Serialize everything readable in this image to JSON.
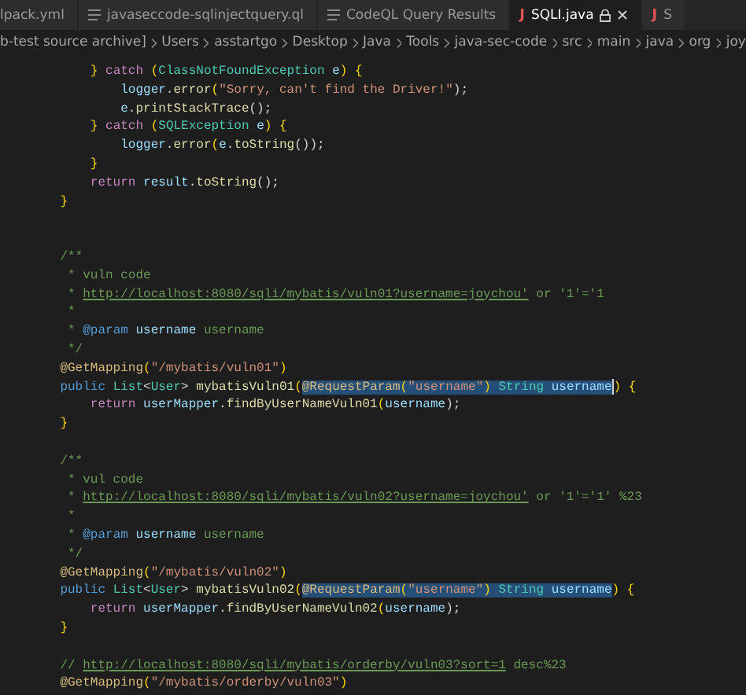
{
  "tabs": [
    {
      "label": "lpack.yml",
      "kind": "plain",
      "selected": false,
      "readonly": false
    },
    {
      "label": "javaseccode-sqlinjectquery.ql",
      "kind": "query",
      "selected": false,
      "readonly": false
    },
    {
      "label": "CodeQL Query Results",
      "kind": "query",
      "selected": false,
      "readonly": false
    },
    {
      "label": "SQLI.java",
      "kind": "java",
      "icon_text": "J",
      "selected": true,
      "readonly": true
    },
    {
      "label": "S",
      "kind": "java",
      "icon_text": "J",
      "selected": false,
      "readonly": false
    }
  ],
  "breadcrumb": [
    "b-test source archive]",
    "Users",
    "asstartgo",
    "Desktop",
    "Java",
    "Tools",
    "java-sec-code",
    "src",
    "main",
    "java",
    "org",
    "joy"
  ],
  "lines": [
    {
      "kind": "code",
      "t": [
        {
          "s": "        } ",
          "kind": "br"
        },
        {
          "s": "catch ",
          "kind": "kw"
        },
        {
          "s": "(",
          "kind": "br"
        },
        {
          "s": "ClassNotFoundException ",
          "kind": "type"
        },
        {
          "s": "e",
          "kind": "var"
        },
        {
          "s": ") {",
          "kind": "br"
        }
      ]
    },
    {
      "kind": "code",
      "t": [
        {
          "s": "            logger",
          "kind": "var"
        },
        {
          "s": ".",
          "kind": "p"
        },
        {
          "s": "error",
          "kind": "fn"
        },
        {
          "s": "(",
          "kind": "br"
        },
        {
          "s": "\"Sorry, can't find the Driver!\"",
          "kind": "str"
        },
        {
          "s": ");",
          "kind": "p"
        }
      ]
    },
    {
      "kind": "code",
      "t": [
        {
          "s": "            e",
          "kind": "var"
        },
        {
          "s": ".",
          "kind": "p"
        },
        {
          "s": "printStackTrace",
          "kind": "fn"
        },
        {
          "s": "();",
          "kind": "p"
        }
      ]
    },
    {
      "kind": "code",
      "t": [
        {
          "s": "        } ",
          "kind": "br"
        },
        {
          "s": "catch ",
          "kind": "kw"
        },
        {
          "s": "(",
          "kind": "br"
        },
        {
          "s": "SQLException ",
          "kind": "type"
        },
        {
          "s": "e",
          "kind": "var"
        },
        {
          "s": ") {",
          "kind": "br"
        }
      ]
    },
    {
      "kind": "code",
      "t": [
        {
          "s": "            logger",
          "kind": "var"
        },
        {
          "s": ".",
          "kind": "p"
        },
        {
          "s": "error",
          "kind": "fn"
        },
        {
          "s": "(",
          "kind": "br"
        },
        {
          "s": "e",
          "kind": "var"
        },
        {
          "s": ".",
          "kind": "p"
        },
        {
          "s": "toString",
          "kind": "fn"
        },
        {
          "s": "());",
          "kind": "p"
        }
      ]
    },
    {
      "kind": "code",
      "t": [
        {
          "s": "        }",
          "kind": "br"
        }
      ]
    },
    {
      "kind": "code",
      "t": [
        {
          "s": "        return ",
          "kind": "kw"
        },
        {
          "s": "result",
          "kind": "var"
        },
        {
          "s": ".",
          "kind": "p"
        },
        {
          "s": "toString",
          "kind": "fn"
        },
        {
          "s": "();",
          "kind": "p"
        }
      ]
    },
    {
      "kind": "code",
      "t": [
        {
          "s": "    }",
          "kind": "br"
        }
      ]
    },
    {
      "kind": "blank"
    },
    {
      "kind": "blank"
    },
    {
      "kind": "code",
      "t": [
        {
          "s": "    /**",
          "kind": "cm"
        }
      ]
    },
    {
      "kind": "code",
      "t": [
        {
          "s": "     * vuln code",
          "kind": "cm"
        }
      ]
    },
    {
      "kind": "code",
      "t": [
        {
          "s": "     * ",
          "kind": "cm"
        },
        {
          "s": "http://localhost:8080/sqli/mybatis/vuln01?username=joychou'",
          "kind": "link"
        },
        {
          "s": " or '1'='1",
          "kind": "cm"
        }
      ]
    },
    {
      "kind": "code",
      "t": [
        {
          "s": "     *",
          "kind": "cm"
        }
      ]
    },
    {
      "kind": "code",
      "t": [
        {
          "s": "     * ",
          "kind": "cm"
        },
        {
          "s": "@param ",
          "kind": "doc"
        },
        {
          "s": "username ",
          "kind": "var"
        },
        {
          "s": "username",
          "kind": "cm"
        }
      ]
    },
    {
      "kind": "code",
      "t": [
        {
          "s": "     */",
          "kind": "cm"
        }
      ]
    },
    {
      "kind": "code",
      "t": [
        {
          "s": "    @GetMapping",
          "kind": "ann"
        },
        {
          "s": "(",
          "kind": "br"
        },
        {
          "s": "\"/mybatis/vuln01\"",
          "kind": "str"
        },
        {
          "s": ")",
          "kind": "br"
        }
      ]
    },
    {
      "kind": "code",
      "t": [
        {
          "s": "    public ",
          "kind": "kw2"
        },
        {
          "s": "List",
          "kind": "type"
        },
        {
          "s": "<",
          "kind": "p"
        },
        {
          "s": "User",
          "kind": "type"
        },
        {
          "s": "> ",
          "kind": "p"
        },
        {
          "s": "mybatisVuln01",
          "kind": "fn"
        },
        {
          "s": "(",
          "kind": "br"
        },
        {
          "kind": "selection",
          "t": [
            {
              "s": "@RequestParam",
              "kind": "ann"
            },
            {
              "s": "(",
              "kind": "br"
            },
            {
              "s": "\"username\"",
              "kind": "str"
            },
            {
              "s": ") ",
              "kind": "br"
            },
            {
              "s": "String ",
              "kind": "type"
            },
            {
              "s": "username",
              "kind": "var"
            }
          ]
        },
        {
          "kind": "cursor"
        },
        {
          "s": ") {",
          "kind": "br"
        }
      ]
    },
    {
      "kind": "code",
      "t": [
        {
          "s": "        return ",
          "kind": "kw"
        },
        {
          "s": "userMapper",
          "kind": "var"
        },
        {
          "s": ".",
          "kind": "p"
        },
        {
          "s": "findByUserNameVuln01",
          "kind": "fn"
        },
        {
          "s": "(",
          "kind": "br"
        },
        {
          "s": "username",
          "kind": "var"
        },
        {
          "s": ");",
          "kind": "p"
        }
      ]
    },
    {
      "kind": "code",
      "t": [
        {
          "s": "    }",
          "kind": "br"
        }
      ]
    },
    {
      "kind": "blank"
    },
    {
      "kind": "code",
      "t": [
        {
          "s": "    /**",
          "kind": "cm"
        }
      ]
    },
    {
      "kind": "code",
      "t": [
        {
          "s": "     * vul code",
          "kind": "cm"
        }
      ]
    },
    {
      "kind": "code",
      "t": [
        {
          "s": "     * ",
          "kind": "cm"
        },
        {
          "s": "http://localhost:8080/sqli/mybatis/vuln02?username=joychou'",
          "kind": "link"
        },
        {
          "s": " or '1'='1' %23",
          "kind": "cm"
        }
      ]
    },
    {
      "kind": "code",
      "t": [
        {
          "s": "     *",
          "kind": "cm"
        }
      ]
    },
    {
      "kind": "code",
      "t": [
        {
          "s": "     * ",
          "kind": "cm"
        },
        {
          "s": "@param ",
          "kind": "doc"
        },
        {
          "s": "username ",
          "kind": "var"
        },
        {
          "s": "username",
          "kind": "cm"
        }
      ]
    },
    {
      "kind": "code",
      "t": [
        {
          "s": "     */",
          "kind": "cm"
        }
      ]
    },
    {
      "kind": "code",
      "t": [
        {
          "s": "    @GetMapping",
          "kind": "ann"
        },
        {
          "s": "(",
          "kind": "br"
        },
        {
          "s": "\"/mybatis/vuln02\"",
          "kind": "str"
        },
        {
          "s": ")",
          "kind": "br"
        }
      ]
    },
    {
      "kind": "code",
      "t": [
        {
          "s": "    public ",
          "kind": "kw2"
        },
        {
          "s": "List",
          "kind": "type"
        },
        {
          "s": "<",
          "kind": "p"
        },
        {
          "s": "User",
          "kind": "type"
        },
        {
          "s": "> ",
          "kind": "p"
        },
        {
          "s": "mybatisVuln02",
          "kind": "fn"
        },
        {
          "s": "(",
          "kind": "br"
        },
        {
          "kind": "selection",
          "t": [
            {
              "s": "@RequestParam",
              "kind": "ann"
            },
            {
              "s": "(",
              "kind": "br"
            },
            {
              "s": "\"username\"",
              "kind": "str"
            },
            {
              "s": ") ",
              "kind": "br"
            },
            {
              "s": "String ",
              "kind": "type"
            },
            {
              "s": "username",
              "kind": "var"
            }
          ]
        },
        {
          "s": ") {",
          "kind": "br"
        }
      ]
    },
    {
      "kind": "code",
      "t": [
        {
          "s": "        return ",
          "kind": "kw"
        },
        {
          "s": "userMapper",
          "kind": "var"
        },
        {
          "s": ".",
          "kind": "p"
        },
        {
          "s": "findByUserNameVuln02",
          "kind": "fn"
        },
        {
          "s": "(",
          "kind": "br"
        },
        {
          "s": "username",
          "kind": "var"
        },
        {
          "s": ");",
          "kind": "p"
        }
      ]
    },
    {
      "kind": "code",
      "t": [
        {
          "s": "    }",
          "kind": "br"
        }
      ]
    },
    {
      "kind": "blank"
    },
    {
      "kind": "code",
      "t": [
        {
          "s": "    // ",
          "kind": "cm"
        },
        {
          "s": "http://localhost:8080/sqli/mybatis/orderby/vuln03?sort=1",
          "kind": "link"
        },
        {
          "s": " desc%23",
          "kind": "cm"
        }
      ]
    },
    {
      "kind": "code",
      "t": [
        {
          "s": "    @GetMapping",
          "kind": "ann"
        },
        {
          "s": "(",
          "kind": "br"
        },
        {
          "s": "\"/mybatis/orderby/vuln03\"",
          "kind": "str"
        },
        {
          "s": ")",
          "kind": "br"
        }
      ]
    }
  ]
}
